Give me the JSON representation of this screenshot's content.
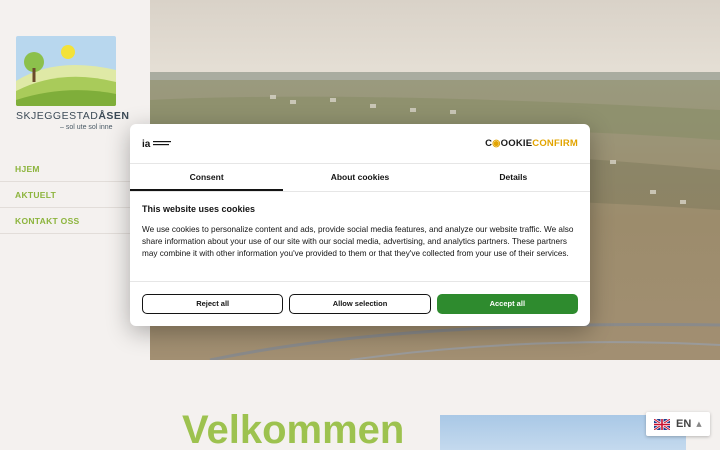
{
  "site": {
    "logo_alt_icon": "sun-hill-logo",
    "name_prefix": "SKJEGGESTAD",
    "name_suffix": "ÅSEN",
    "tagline": "– sol ute sol inne"
  },
  "nav": {
    "items": [
      {
        "label": "HJEM"
      },
      {
        "label": "AKTUELT"
      },
      {
        "label": "KONTAKT OSS"
      }
    ]
  },
  "main": {
    "heading": "Velkommen"
  },
  "language": {
    "code": "EN",
    "flag_icon": "uk-flag-icon",
    "caret_icon": "caret-up-icon"
  },
  "cookie_dialog": {
    "brand_logo_icon": "ia-logo",
    "brand_prefix": "C",
    "brand_mid": "OOKIE",
    "brand_confirm": "CONFIRM",
    "tabs": [
      {
        "label": "Consent",
        "active": true
      },
      {
        "label": "About cookies",
        "active": false
      },
      {
        "label": "Details",
        "active": false
      }
    ],
    "title": "This website uses cookies",
    "body": "We use cookies to personalize content and ads, provide social media features, and analyze our website traffic. We also share information about your use of our site with our social media, advertising, and analytics partners. These partners may combine it with other information you've provided to them or that they've collected from your use of their services.",
    "buttons": {
      "reject": "Reject all",
      "allow_selection": "Allow selection",
      "accept": "Accept all"
    }
  },
  "colors": {
    "accent_green": "#8cb43c",
    "accept_button": "#2e8b2e",
    "background": "#f4f1ef"
  }
}
